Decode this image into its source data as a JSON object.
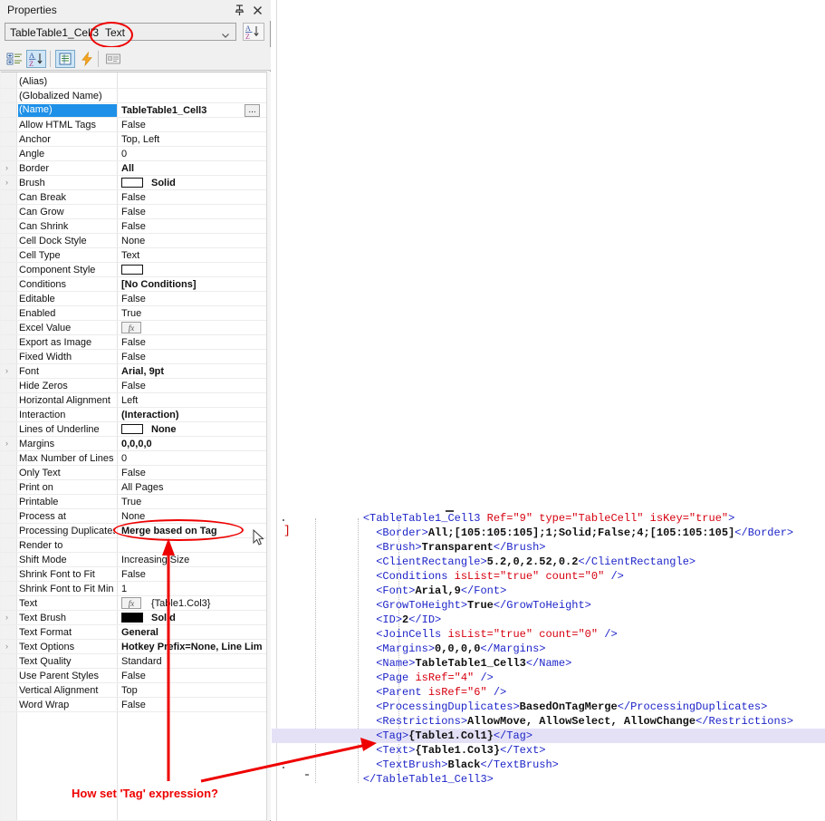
{
  "panel": {
    "title": "Properties",
    "pin_icon": "pin-icon",
    "close_icon": "close-icon",
    "object_name": "TableTable1_Cell3",
    "object_type": "Text",
    "toolbar": [
      {
        "name": "categorized-view-button",
        "label": "categorized"
      },
      {
        "name": "alphabetical-sort-button",
        "label": "A-Z sort"
      },
      {
        "name": "properties-view-button",
        "label": "properties"
      },
      {
        "name": "events-view-button",
        "label": "events"
      },
      {
        "name": "property-pages-button",
        "label": "property pages"
      }
    ]
  },
  "grid": {
    "rows": [
      {
        "name": "(Alias)",
        "value": "",
        "expander": false,
        "selected": false
      },
      {
        "name": "(Globalized Name)",
        "value": "",
        "expander": false,
        "selected": false
      },
      {
        "name": "(Name)",
        "value": "TableTable1_Cell3",
        "expander": false,
        "selected": true,
        "bold": true,
        "ellipsis": "..."
      },
      {
        "name": "Allow HTML Tags",
        "value": "False",
        "expander": false,
        "selected": false
      },
      {
        "name": "Anchor",
        "value": "Top, Left",
        "expander": false,
        "selected": false
      },
      {
        "name": "Angle",
        "value": "0",
        "expander": false,
        "selected": false
      },
      {
        "name": "Border",
        "value": "All",
        "expander": true,
        "selected": false,
        "bold": true
      },
      {
        "name": "Brush",
        "value": "Solid",
        "expander": true,
        "selected": false,
        "swatch": "#ffffff"
      },
      {
        "name": "Can Break",
        "value": "False",
        "expander": false,
        "selected": false
      },
      {
        "name": "Can Grow",
        "value": "False",
        "expander": false,
        "selected": false
      },
      {
        "name": "Can Shrink",
        "value": "False",
        "expander": false,
        "selected": false
      },
      {
        "name": "Cell Dock Style",
        "value": "None",
        "expander": false,
        "selected": false
      },
      {
        "name": "Cell Type",
        "value": "Text",
        "expander": false,
        "selected": false
      },
      {
        "name": "Component Style",
        "value": "",
        "expander": false,
        "selected": false,
        "swatch": "#ffffff"
      },
      {
        "name": "Conditions",
        "value": "[No Conditions]",
        "expander": false,
        "selected": false,
        "bold": true
      },
      {
        "name": "Editable",
        "value": "False",
        "expander": false,
        "selected": false
      },
      {
        "name": "Enabled",
        "value": "True",
        "expander": false,
        "selected": false
      },
      {
        "name": "Excel Value",
        "value": "",
        "expander": false,
        "selected": false,
        "fx": "fx"
      },
      {
        "name": "Export as Image",
        "value": "False",
        "expander": false,
        "selected": false
      },
      {
        "name": "Fixed Width",
        "value": "False",
        "expander": false,
        "selected": false
      },
      {
        "name": "Font",
        "value": "Arial, 9pt",
        "expander": true,
        "selected": false,
        "bold": true
      },
      {
        "name": "Hide Zeros",
        "value": "False",
        "expander": false,
        "selected": false
      },
      {
        "name": "Horizontal Alignment",
        "value": "Left",
        "expander": false,
        "selected": false
      },
      {
        "name": "Interaction",
        "value": "(Interaction)",
        "expander": false,
        "selected": false,
        "bold": true
      },
      {
        "name": "Lines of Underline",
        "value": "None",
        "expander": false,
        "selected": false,
        "swatch": "#ffffff"
      },
      {
        "name": "Margins",
        "value": "0,0,0,0",
        "expander": true,
        "selected": false,
        "bold": true
      },
      {
        "name": "Max Number of Lines",
        "value": "0",
        "expander": false,
        "selected": false
      },
      {
        "name": "Only Text",
        "value": "False",
        "expander": false,
        "selected": false
      },
      {
        "name": "Print on",
        "value": "All Pages",
        "expander": false,
        "selected": false
      },
      {
        "name": "Printable",
        "value": "True",
        "expander": false,
        "selected": false
      },
      {
        "name": "Process at",
        "value": "None",
        "expander": false,
        "selected": false
      },
      {
        "name": "Processing Duplicates",
        "value": "Merge based on Tag",
        "expander": false,
        "selected": false,
        "bold": true
      },
      {
        "name": "Render to",
        "value": "",
        "expander": false,
        "selected": false
      },
      {
        "name": "Shift Mode",
        "value": "Increasing Size",
        "expander": false,
        "selected": false
      },
      {
        "name": "Shrink Font to Fit",
        "value": "False",
        "expander": false,
        "selected": false
      },
      {
        "name": "Shrink Font to Fit Min",
        "value": "1",
        "expander": false,
        "selected": false
      },
      {
        "name": "Text",
        "value": "{Table1.Col3}",
        "expander": false,
        "selected": false,
        "fx": "fx"
      },
      {
        "name": "Text Brush",
        "value": "Solid",
        "expander": true,
        "selected": false,
        "swatch": "#000000"
      },
      {
        "name": "Text Format",
        "value": "General",
        "expander": false,
        "selected": false,
        "bold": true
      },
      {
        "name": "Text Options",
        "value": "Hotkey Prefix=None, Line Limit",
        "expander": true,
        "selected": false,
        "bold": true
      },
      {
        "name": "Text Quality",
        "value": "Standard",
        "expander": false,
        "selected": false
      },
      {
        "name": "Use Parent Styles",
        "value": "False",
        "expander": false,
        "selected": false
      },
      {
        "name": "Vertical Alignment",
        "value": "Top",
        "expander": false,
        "selected": false
      },
      {
        "name": "Word Wrap",
        "value": "False",
        "expander": false,
        "selected": false
      }
    ]
  },
  "annotation": {
    "question": "How set 'Tag' expression?",
    "color": "#ee0000"
  },
  "code": {
    "lines": [
      {
        "indent": 0,
        "segments": [
          {
            "t": "tag",
            "s": "<TableTable1_Cell3 "
          },
          {
            "t": "attr",
            "s": "Ref=\"9\" type=\"TableCell\" isKey=\"true\""
          },
          {
            "t": "tag",
            "s": ">"
          }
        ]
      },
      {
        "indent": 1,
        "segments": [
          {
            "t": "tag",
            "s": "<Border>"
          },
          {
            "t": "txt",
            "s": "All;[105:105:105];1;Solid;False;4;[105:105:105]"
          },
          {
            "t": "tag",
            "s": "</Border>"
          }
        ]
      },
      {
        "indent": 1,
        "segments": [
          {
            "t": "tag",
            "s": "<Brush>"
          },
          {
            "t": "txt",
            "s": "Transparent"
          },
          {
            "t": "tag",
            "s": "</Brush>"
          }
        ]
      },
      {
        "indent": 1,
        "segments": [
          {
            "t": "tag",
            "s": "<ClientRectangle>"
          },
          {
            "t": "txt",
            "s": "5.2,0,2.52,0.2"
          },
          {
            "t": "tag",
            "s": "</ClientRectangle>"
          }
        ]
      },
      {
        "indent": 1,
        "segments": [
          {
            "t": "tag",
            "s": "<Conditions "
          },
          {
            "t": "attr",
            "s": "isList=\"true\" count=\"0\""
          },
          {
            "t": "tag",
            "s": " />"
          }
        ]
      },
      {
        "indent": 1,
        "segments": [
          {
            "t": "tag",
            "s": "<Font>"
          },
          {
            "t": "txt",
            "s": "Arial,9"
          },
          {
            "t": "tag",
            "s": "</Font>"
          }
        ]
      },
      {
        "indent": 1,
        "segments": [
          {
            "t": "tag",
            "s": "<GrowToHeight>"
          },
          {
            "t": "txt",
            "s": "True"
          },
          {
            "t": "tag",
            "s": "</GrowToHeight>"
          }
        ]
      },
      {
        "indent": 1,
        "segments": [
          {
            "t": "tag",
            "s": "<ID>"
          },
          {
            "t": "txt",
            "s": "2"
          },
          {
            "t": "tag",
            "s": "</ID>"
          }
        ]
      },
      {
        "indent": 1,
        "segments": [
          {
            "t": "tag",
            "s": "<JoinCells "
          },
          {
            "t": "attr",
            "s": "isList=\"true\" count=\"0\""
          },
          {
            "t": "tag",
            "s": " />"
          }
        ]
      },
      {
        "indent": 1,
        "segments": [
          {
            "t": "tag",
            "s": "<Margins>"
          },
          {
            "t": "txt",
            "s": "0,0,0,0"
          },
          {
            "t": "tag",
            "s": "</Margins>"
          }
        ]
      },
      {
        "indent": 1,
        "segments": [
          {
            "t": "tag",
            "s": "<Name>"
          },
          {
            "t": "txt",
            "s": "TableTable1_Cell3"
          },
          {
            "t": "tag",
            "s": "</Name>"
          }
        ]
      },
      {
        "indent": 1,
        "segments": [
          {
            "t": "tag",
            "s": "<Page "
          },
          {
            "t": "attr",
            "s": "isRef=\"4\""
          },
          {
            "t": "tag",
            "s": " />"
          }
        ]
      },
      {
        "indent": 1,
        "segments": [
          {
            "t": "tag",
            "s": "<Parent "
          },
          {
            "t": "attr",
            "s": "isRef=\"6\""
          },
          {
            "t": "tag",
            "s": " />"
          }
        ]
      },
      {
        "indent": 1,
        "segments": [
          {
            "t": "tag",
            "s": "<ProcessingDuplicates>"
          },
          {
            "t": "txt",
            "s": "BasedOnTagMerge"
          },
          {
            "t": "tag",
            "s": "</ProcessingDuplicates>"
          }
        ]
      },
      {
        "indent": 1,
        "highlight": false,
        "segments": [
          {
            "t": "tag",
            "s": "<Restrictions>"
          },
          {
            "t": "txt",
            "s": "AllowMove, AllowSelect, AllowChange"
          },
          {
            "t": "tag",
            "s": "</Restrictions>"
          }
        ]
      },
      {
        "indent": 1,
        "highlight": true,
        "segments": [
          {
            "t": "tag",
            "s": "<Tag>"
          },
          {
            "t": "txt",
            "s": "{Table1.Col1}"
          },
          {
            "t": "tag",
            "s": "</Tag>"
          }
        ]
      },
      {
        "indent": 1,
        "segments": [
          {
            "t": "tag",
            "s": "<Text>"
          },
          {
            "t": "txt",
            "s": "{Table1.Col3}"
          },
          {
            "t": "tag",
            "s": "</Text>"
          }
        ]
      },
      {
        "indent": 1,
        "segments": [
          {
            "t": "tag",
            "s": "<TextBrush>"
          },
          {
            "t": "txt",
            "s": "Black"
          },
          {
            "t": "tag",
            "s": "</TextBrush>"
          }
        ]
      },
      {
        "indent": 0,
        "segments": [
          {
            "t": "tag",
            "s": "</TableTable1_Cell3>"
          }
        ]
      }
    ]
  }
}
